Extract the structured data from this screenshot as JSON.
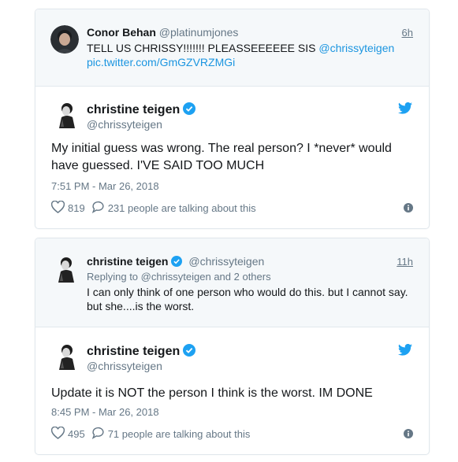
{
  "tweets": [
    {
      "quoted": {
        "name": "Conor Behan",
        "handle": "@platinumjones",
        "time": "6h",
        "text_plain": "TELL US CHRISSY!!!!!!! PLEASSEEEEEE SIS ",
        "mention": "@chrissyteigen",
        "link": "pic.twitter.com/GmGZVRZMGi"
      },
      "author": {
        "name": "christine teigen",
        "handle": "@chrissyteigen"
      },
      "body": "My initial guess was wrong. The real person? I *never* would have guessed. I'VE SAID TOO MUCH",
      "timestamp": "7:51 PM - Mar 26, 2018",
      "likes": "819",
      "talking": "231 people are talking about this"
    },
    {
      "quoted": {
        "name": "christine teigen",
        "handle": "@chrissyteigen",
        "time": "11h",
        "replying": "Replying to @chrissyteigen and 2 others",
        "text_plain": "I can only think of one person who would do this. but I cannot say. but she....is the worst."
      },
      "author": {
        "name": "christine teigen",
        "handle": "@chrissyteigen"
      },
      "body": "Update it is NOT the person I think is the worst. IM DONE",
      "timestamp": "8:45 PM - Mar 26, 2018",
      "likes": "495",
      "talking": "71 people are talking about this"
    }
  ],
  "colors": {
    "twitter_blue": "#1da1f2",
    "link": "#1b95e0",
    "muted": "#657786"
  },
  "icons": [
    "twitter-bird-icon",
    "verified-badge-icon",
    "heart-icon",
    "comment-bubble-icon",
    "info-icon"
  ]
}
